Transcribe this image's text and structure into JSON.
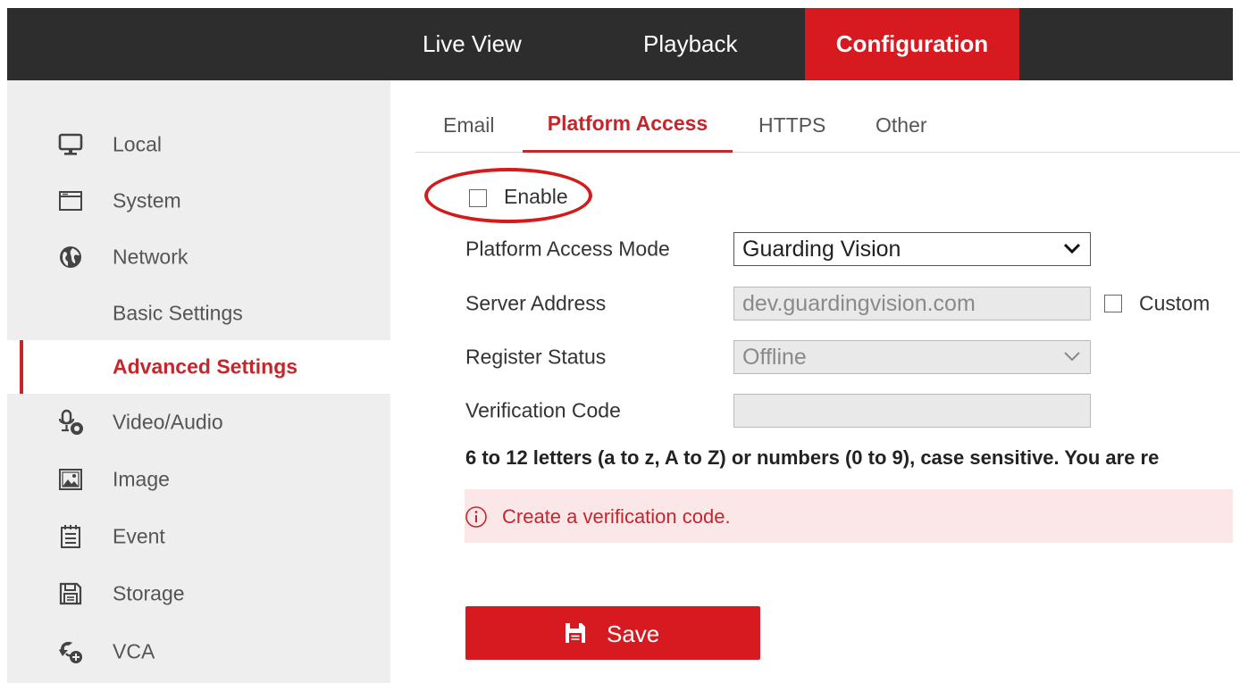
{
  "topnav": {
    "live_view": "Live View",
    "playback": "Playback",
    "configuration": "Configuration"
  },
  "sidebar": {
    "items": [
      {
        "label": "Local",
        "icon": "monitor-icon"
      },
      {
        "label": "System",
        "icon": "window-icon"
      },
      {
        "label": "Network",
        "icon": "globe-icon"
      },
      {
        "label": "Basic Settings",
        "icon": ""
      },
      {
        "label": "Advanced Settings",
        "icon": ""
      },
      {
        "label": "Video/Audio",
        "icon": "microphone-icon"
      },
      {
        "label": "Image",
        "icon": "image-icon"
      },
      {
        "label": "Event",
        "icon": "calendar-icon"
      },
      {
        "label": "Storage",
        "icon": "floppy-icon"
      },
      {
        "label": "VCA",
        "icon": "vca-icon"
      }
    ],
    "active_index": 4
  },
  "tabs": {
    "email": "Email",
    "platform_access": "Platform Access",
    "https": "HTTPS",
    "other": "Other"
  },
  "form": {
    "enable_label": "Enable",
    "enable_checked": false,
    "mode_label": "Platform Access Mode",
    "mode_value": "Guarding Vision",
    "server_label": "Server Address",
    "server_value": "dev.guardingvision.com",
    "custom_label": "Custom",
    "custom_checked": false,
    "status_label": "Register Status",
    "status_value": "Offline",
    "code_label": "Verification Code",
    "code_value": ""
  },
  "hint": "6 to 12 letters (a to z, A to Z) or numbers (0 to 9), case sensitive. You are re",
  "alert": {
    "text": "Create a verification code."
  },
  "save_label": "Save",
  "colors": {
    "accent": "#d71920",
    "topbar": "#2d2d2d",
    "sidebar_bg": "#eeeeee",
    "highlight_ring": "#d21b1b",
    "alert_bg": "#fbe7e8"
  }
}
